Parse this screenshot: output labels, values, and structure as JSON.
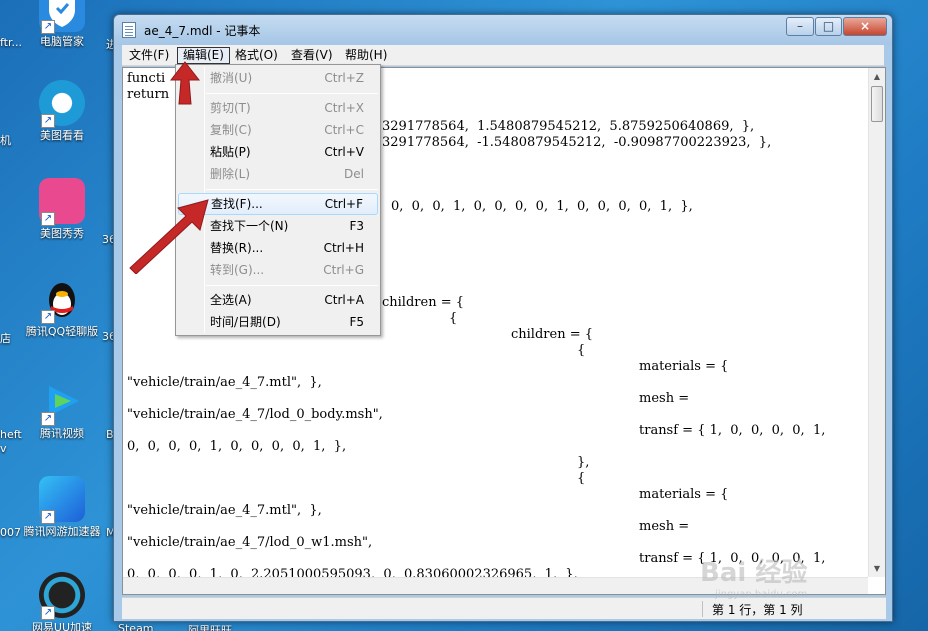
{
  "desktop": {
    "icons": [
      {
        "label": "电脑管家",
        "color": "#2a8ae0"
      },
      {
        "label": "美图看看",
        "color": "#1e9bd7"
      },
      {
        "label": "美图秀秀",
        "color": "#e94a8f"
      },
      {
        "label": "腾讯QQ轻聊版",
        "color": "#ffffff"
      },
      {
        "label": "腾讯视频",
        "color": "#20a0f0"
      },
      {
        "label": "腾讯网游加速器",
        "color": "#1d7ad8"
      },
      {
        "label": "网易UU加速",
        "color": "#222222"
      }
    ],
    "left_partial": [
      "ftr...",
      "机",
      "",
      "",
      "店",
      "heft",
      "v",
      "007",
      ""
    ],
    "right_partial": [
      "进",
      "36",
      "36",
      "B",
      "M"
    ],
    "bottom_partial": [
      "Steam",
      "阿里旺旺"
    ]
  },
  "window": {
    "title": "ae_4_7.mdl - 记事本",
    "controls": {
      "minimize": "–",
      "maximize": "□",
      "close": "×"
    }
  },
  "menubar": [
    {
      "label": "文件(F)",
      "active": false
    },
    {
      "label": "编辑(E)",
      "active": true
    },
    {
      "label": "格式(O)",
      "active": false
    },
    {
      "label": "查看(V)",
      "active": false
    },
    {
      "label": "帮助(H)",
      "active": false
    }
  ],
  "edit_menu": [
    {
      "label": "撤消(U)",
      "shortcut": "Ctrl+Z",
      "disabled": true
    },
    {
      "label": "剪切(T)",
      "shortcut": "Ctrl+X",
      "disabled": true
    },
    {
      "label": "复制(C)",
      "shortcut": "Ctrl+C",
      "disabled": true
    },
    {
      "label": "粘贴(P)",
      "shortcut": "Ctrl+V",
      "disabled": false
    },
    {
      "label": "删除(L)",
      "shortcut": "Del",
      "disabled": true
    },
    {
      "label": "查找(F)...",
      "shortcut": "Ctrl+F",
      "disabled": false,
      "highlighted": true
    },
    {
      "label": "查找下一个(N)",
      "shortcut": "F3",
      "disabled": false
    },
    {
      "label": "替换(R)...",
      "shortcut": "Ctrl+H",
      "disabled": false
    },
    {
      "label": "转到(G)...",
      "shortcut": "Ctrl+G",
      "disabled": true
    },
    {
      "label": "全选(A)",
      "shortcut": "Ctrl+A",
      "disabled": false
    },
    {
      "label": "时间/日期(D)",
      "shortcut": "F5",
      "disabled": false
    }
  ],
  "editor_lines": [
    "functi",
    "return",
    "3291778564,  1.5480879545212,  5.8759250640869,  },",
    "3291778564,  -1.5480879545212,  -0.90987700223923,  },",
    "0,  0,  0,  1,  0,  0,  0,  0,  1,  0,  0,  0,  0,  1,  },",
    "children = {",
    "{",
    "children = {",
    "{",
    "materials = {",
    "\"vehicle/train/ae_4_7.mtl\",  },",
    "mesh =",
    "\"vehicle/train/ae_4_7/lod_0_body.msh\",",
    "transf = { 1,  0,  0,  0,  0,  1,",
    "0,  0,  0,  0,  1,  0,  0,  0,  0,  1,  },",
    "},",
    "{",
    "materials = {",
    "\"vehicle/train/ae_4_7.mtl\",  },",
    "mesh =",
    "\"vehicle/train/ae_4_7/lod_0_w1.msh\",",
    "transf = { 1,  0,  0,  0,  0,  1,",
    "0,  0,  0,  0,  1,  0,  2.2051000595093,  0,  0.83060002326965,  1,  },"
  ],
  "status": {
    "position": "第 1 行，第 1 列"
  },
  "watermark": {
    "main": "Bai 经验",
    "sub": "jingyan.baidu.com"
  }
}
